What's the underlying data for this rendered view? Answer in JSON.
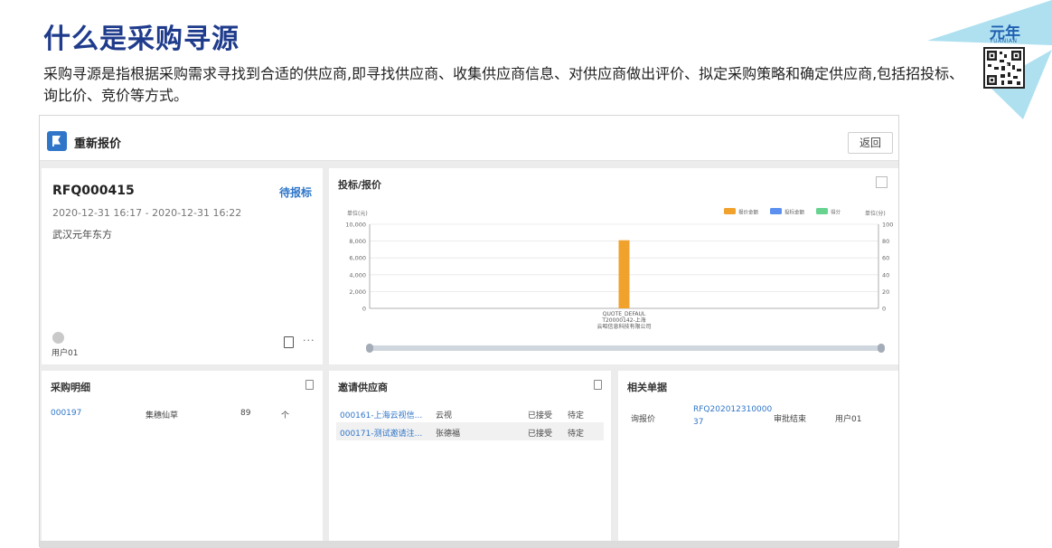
{
  "slide": {
    "title": "什么是采购寻源",
    "description": "采购寻源是指根据采购需求寻找到合适的供应商,即寻找供应商、收集供应商信息、对供应商做出评价、拟定采购策略和确定供应商,包括招投标、询比价、竞价等方式。",
    "brand_name": "元年",
    "brand_sub": "YUANIAN"
  },
  "app": {
    "title": "重新报价",
    "back_label": "返回"
  },
  "rfq": {
    "number": "RFQ000415",
    "status": "待报标",
    "time_range": "2020-12-31 16:17  -  2020-12-31 16:22",
    "company": "武汉元年东方",
    "user": "用户01",
    "more": "···"
  },
  "chart_panel": {
    "title": "投标/报价"
  },
  "chart_data": {
    "type": "bar",
    "categories": [
      "QUOTE_DEFAUL T20000142-上海云昭信息科技有限公司"
    ],
    "category_lines": [
      "QUOTE_DEFAUL",
      "T20000142-上海",
      "云昭信息科技有限公司"
    ],
    "series": [
      {
        "name": "报价金额",
        "values": [
          8100
        ],
        "color": "#f0a22d",
        "axis": "left"
      },
      {
        "name": "投标金额",
        "values": [
          0
        ],
        "color": "#5b8ff0",
        "axis": "left"
      },
      {
        "name": "得分",
        "values": [
          0
        ],
        "color": "#67d38f",
        "axis": "right"
      }
    ],
    "ylabel_left": "单位(元)",
    "ylabel_right": "单位(分)",
    "ylim_left": [
      0,
      10000
    ],
    "yticks_left": [
      "10,000",
      "8,000",
      "6,000",
      "4,000",
      "2,000",
      "0"
    ],
    "ylim_right": [
      0,
      100
    ],
    "yticks_right": [
      "100",
      "80",
      "60",
      "40",
      "20",
      "0"
    ],
    "legend_position": "top-right",
    "grid": true
  },
  "purchase_detail": {
    "title": "采购明细",
    "rows": [
      {
        "code": "000197",
        "name": "集穗仙草",
        "qty": "89",
        "unit": "个"
      }
    ]
  },
  "suppliers": {
    "title": "邀请供应商",
    "rows": [
      {
        "code": "000161-上海云视信...",
        "name": "云视",
        "accept": "已接受",
        "status": "待定"
      },
      {
        "code": "000171-测试邀请注...",
        "name": "张德福",
        "accept": "已接受",
        "status": "待定"
      }
    ]
  },
  "related": {
    "title": "相关单据",
    "rows": [
      {
        "type": "询报价",
        "doc_line1": "RFQ202012310000",
        "doc_line2": "37",
        "state": "审批结束",
        "user": "用户01"
      }
    ]
  }
}
